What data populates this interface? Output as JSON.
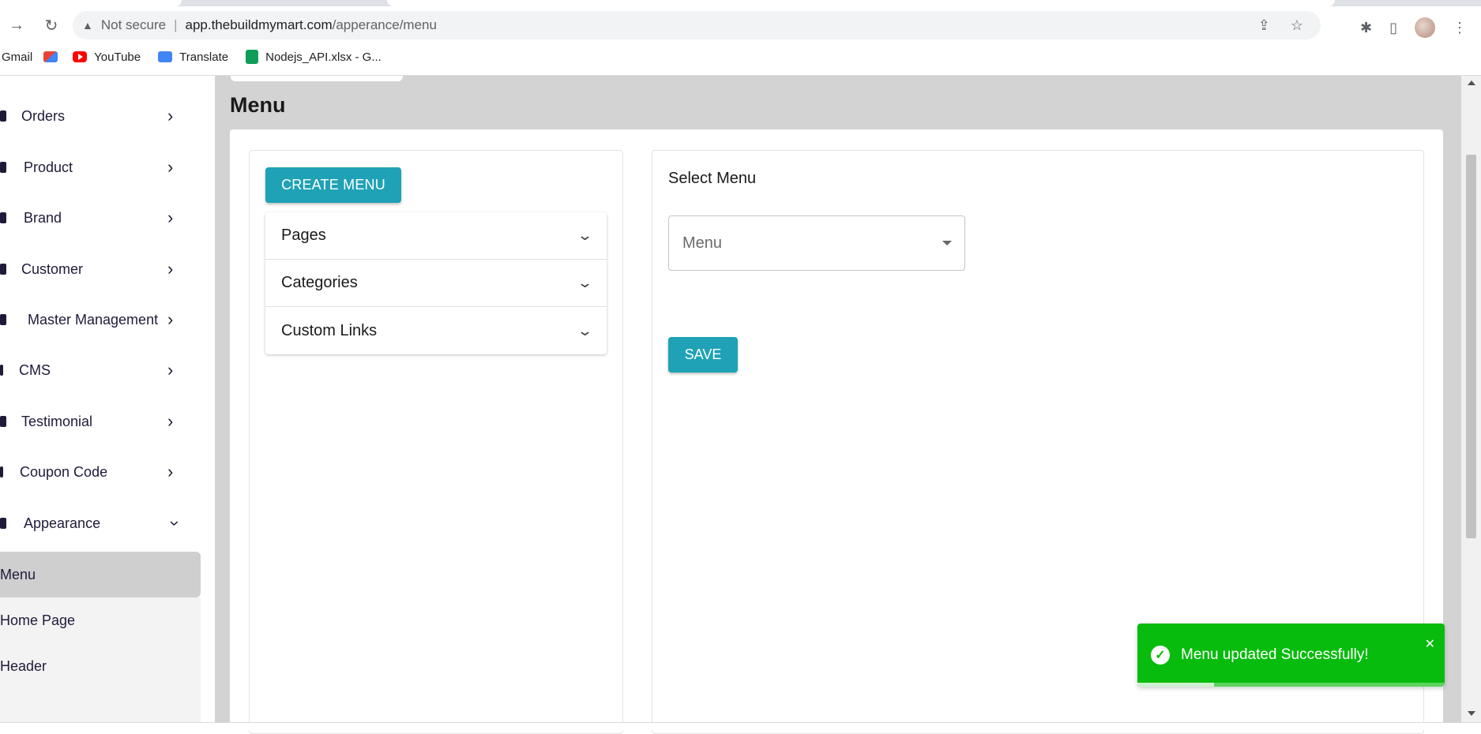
{
  "browser": {
    "security_label": "Not secure",
    "url_host": "app.thebuildmymart.com",
    "url_path": "/apperance/menu",
    "bookmarks": [
      {
        "label": "Gmail",
        "icon": "gmail-icon"
      },
      {
        "label": "YouTube",
        "icon": "youtube-icon"
      },
      {
        "label": "Translate",
        "icon": "translate-icon"
      },
      {
        "label": "Nodejs_API.xlsx - G...",
        "icon": "sheets-icon"
      }
    ]
  },
  "sidebar": {
    "items": [
      {
        "label": "Orders",
        "expanded": false
      },
      {
        "label": "Product",
        "expanded": false
      },
      {
        "label": "Brand",
        "expanded": false
      },
      {
        "label": "Customer",
        "expanded": false
      },
      {
        "label": "Master Management",
        "expanded": false
      },
      {
        "label": "CMS",
        "expanded": false
      },
      {
        "label": "Testimonial",
        "expanded": false
      },
      {
        "label": "Coupon Code",
        "expanded": false
      },
      {
        "label": "Appearance",
        "expanded": true
      }
    ],
    "subitems": [
      {
        "label": "Menu",
        "active": true
      },
      {
        "label": "Home Page",
        "active": false
      },
      {
        "label": "Header",
        "active": false
      }
    ]
  },
  "main": {
    "title": "Menu",
    "create_button": "CREATE MENU",
    "accordion": [
      {
        "label": "Pages"
      },
      {
        "label": "Categories"
      },
      {
        "label": "Custom Links"
      }
    ],
    "select_label": "Select Menu",
    "select_placeholder": "Menu",
    "save_button": "SAVE"
  },
  "toast": {
    "message": "Menu updated Successfully!",
    "progress": 0.25,
    "color": "#07bc0c"
  },
  "colors": {
    "primary": "#1fa2b6",
    "content_bg": "#d3d3d3",
    "active_sub": "#cfcfcf"
  }
}
